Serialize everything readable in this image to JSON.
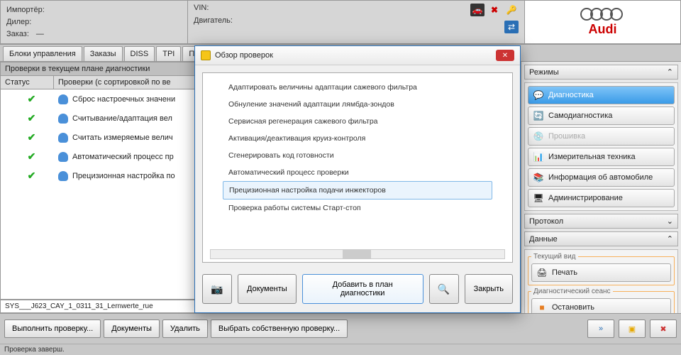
{
  "header": {
    "importer_label": "Импортёр:",
    "dealer_label": "Дилер:",
    "order_label": "Заказ:",
    "order_value": "—",
    "vin_label": "VIN:",
    "engine_label": "Двигатель:"
  },
  "brand": "Audi",
  "tabs": [
    "Блоки управления",
    "Заказы",
    "DISS",
    "TPI",
    "План д"
  ],
  "section_title": "Проверки в текущем плане диагностики",
  "columns": {
    "status": "Статус",
    "name": "Проверки (с сортировкой по ве"
  },
  "rows": [
    {
      "label": "Сброс настроечных значени"
    },
    {
      "label": "Считывание/адаптация вел"
    },
    {
      "label": "Считать измеряемые велич"
    },
    {
      "label": "Автоматический процесс пр"
    },
    {
      "label": "Прецизионная настройка по"
    }
  ],
  "sys_line": "SYS___J623_CAY_1_0311_31_Lernwerte_rue",
  "bottom_buttons": {
    "run": "Выполнить проверку...",
    "docs": "Документы",
    "delete": "Удалить",
    "select": "Выбрать собственную проверку..."
  },
  "status_bar": "Проверка заверш.",
  "right": {
    "modes_title": "Режимы",
    "modes": [
      {
        "label": "Диагностика",
        "state": "active",
        "icon": "💬"
      },
      {
        "label": "Самодиагностика",
        "state": "",
        "icon": "🔄"
      },
      {
        "label": "Прошивка",
        "state": "disabled",
        "icon": "💿"
      },
      {
        "label": "Измерительная техника",
        "state": "",
        "icon": "📊"
      },
      {
        "label": "Информация об автомобиле",
        "state": "",
        "icon": "📚"
      },
      {
        "label": "Администрирование",
        "state": "",
        "icon": "🖥"
      }
    ],
    "protocol_title": "Протокол",
    "data_title": "Данные",
    "view_group": "Текущий вид",
    "print": "Печать",
    "session_group": "Диагностический сеанс",
    "stop": "Остановить"
  },
  "dialog": {
    "title": "Обзор проверок",
    "items": [
      "Адаптировать величины адаптации сажевого фильтра",
      "Обнуление значений адаптации лямбда-зондов",
      "Сервисная регенерация сажевого фильтра",
      "Активация/деактивация круиз-контроля",
      "Сгенерировать код готовности",
      "Автоматический процесс проверки",
      "Прецизионная настройка подачи инжекторов",
      "Проверка работы системы Старт-стоп"
    ],
    "selected_index": 6,
    "buttons": {
      "docs": "Документы",
      "add": "Добавить в план диагностики",
      "close": "Закрыть"
    }
  }
}
